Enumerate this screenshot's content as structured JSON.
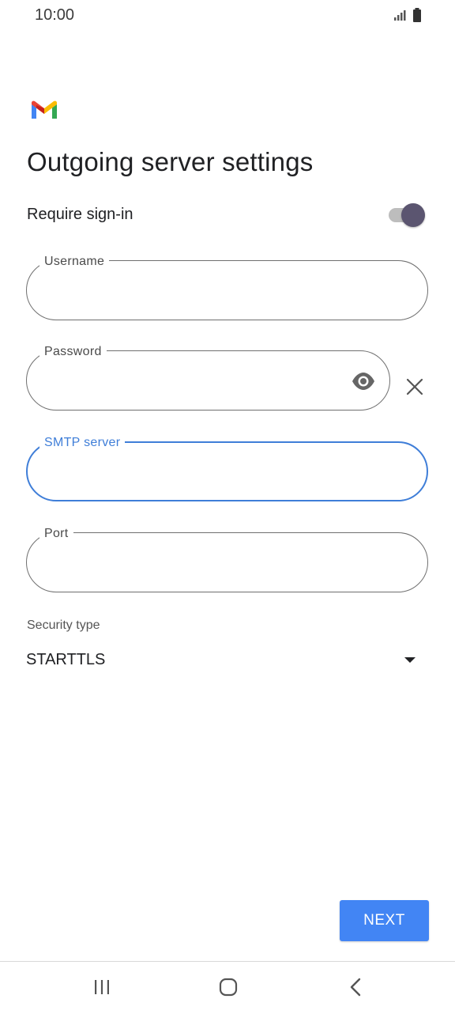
{
  "status_bar": {
    "time": "10:00"
  },
  "page": {
    "title": "Outgoing server settings"
  },
  "require_signin": {
    "label": "Require sign-in",
    "enabled": true
  },
  "fields": {
    "username": {
      "label": "Username",
      "value": ""
    },
    "password": {
      "label": "Password",
      "value": ""
    },
    "smtp_server": {
      "label": "SMTP server",
      "value": ""
    },
    "port": {
      "label": "Port",
      "value": ""
    }
  },
  "security_type": {
    "label": "Security type",
    "value": "STARTTLS"
  },
  "actions": {
    "next_label": "NEXT"
  },
  "colors": {
    "accent": "#4285f4",
    "focus": "#3f7ed8",
    "toggle_thumb": "#5b5570"
  },
  "icons": [
    "gmail-logo",
    "eye-icon",
    "close-icon",
    "signal-icon",
    "battery-icon",
    "recents-icon",
    "home-icon",
    "back-icon"
  ]
}
